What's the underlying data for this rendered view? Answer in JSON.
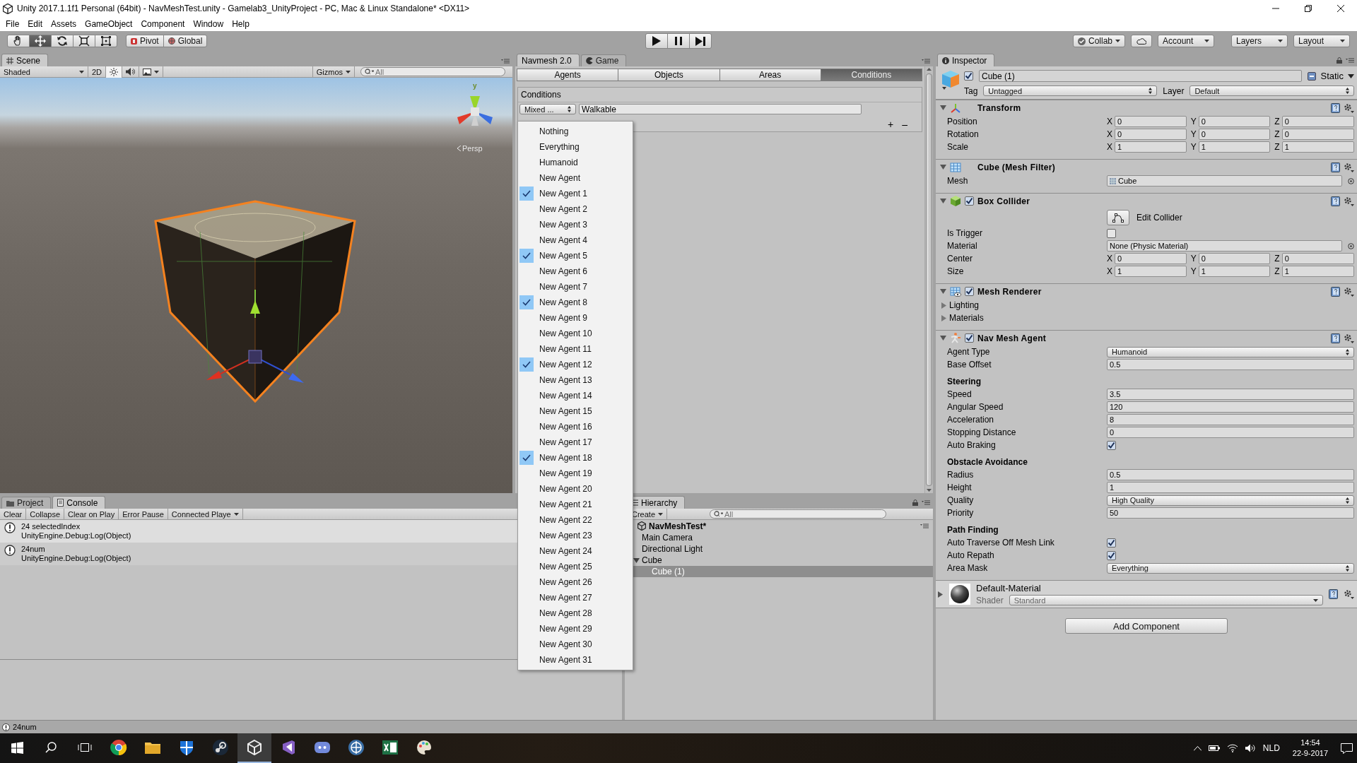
{
  "window": {
    "title": "Unity 2017.1.1f1 Personal (64bit) - NavMeshTest.unity - Gamelab3_UnityProject - PC, Mac & Linux Standalone* <DX11>"
  },
  "menu": [
    "File",
    "Edit",
    "Assets",
    "GameObject",
    "Component",
    "Window",
    "Help"
  ],
  "toolbar": {
    "tools": [
      {
        "kind": "hand",
        "selected": false
      },
      {
        "kind": "move",
        "selected": true
      },
      {
        "kind": "rotate",
        "selected": false
      },
      {
        "kind": "scale",
        "selected": false
      },
      {
        "kind": "rect",
        "selected": false
      }
    ],
    "pivot": "Pivot",
    "global": "Global",
    "collab": "Collab",
    "account": "Account",
    "layers": "Layers",
    "layout": "Layout"
  },
  "scene": {
    "tabs": [
      {
        "kind": "scene",
        "label": "Scene",
        "selected": true
      }
    ],
    "shading": "Shaded",
    "mode_2d": "2D",
    "lighting_on": true,
    "audio_on": false,
    "gizmos": "Gizmos",
    "search_placeholder": "All",
    "gizmo_label": "y",
    "projection": "Persp"
  },
  "navmesh": {
    "tabs": [
      {
        "kind": "plain",
        "label": "Navmesh 2.0",
        "selected": true
      },
      {
        "kind": "game",
        "label": "Game",
        "selected": false
      }
    ],
    "subtabs": [
      {
        "label": "Agents",
        "selected": false
      },
      {
        "label": "Objects",
        "selected": false
      },
      {
        "label": "Areas",
        "selected": false
      },
      {
        "label": "Conditions",
        "selected": true
      }
    ],
    "section": "Conditions",
    "mask": "Mixed ...",
    "name": "Walkable",
    "add": "+",
    "remove": "–",
    "menu": {
      "items": [
        {
          "label": "Nothing",
          "checked": false
        },
        {
          "label": "Everything",
          "checked": false
        },
        {
          "label": "Humanoid",
          "checked": false
        },
        {
          "label": "New Agent",
          "checked": false
        },
        {
          "label": "New Agent 1",
          "checked": true
        },
        {
          "label": "New Agent 2",
          "checked": false
        },
        {
          "label": "New Agent 3",
          "checked": false
        },
        {
          "label": "New Agent 4",
          "checked": false
        },
        {
          "label": "New Agent 5",
          "checked": true
        },
        {
          "label": "New Agent 6",
          "checked": false
        },
        {
          "label": "New Agent 7",
          "checked": false
        },
        {
          "label": "New Agent 8",
          "checked": true
        },
        {
          "label": "New Agent 9",
          "checked": false
        },
        {
          "label": "New Agent 10",
          "checked": false
        },
        {
          "label": "New Agent 11",
          "checked": false
        },
        {
          "label": "New Agent 12",
          "checked": true
        },
        {
          "label": "New Agent 13",
          "checked": false
        },
        {
          "label": "New Agent 14",
          "checked": false
        },
        {
          "label": "New Agent 15",
          "checked": false
        },
        {
          "label": "New Agent 16",
          "checked": false
        },
        {
          "label": "New Agent 17",
          "checked": false
        },
        {
          "label": "New Agent 18",
          "checked": true
        },
        {
          "label": "New Agent 19",
          "checked": false
        },
        {
          "label": "New Agent 20",
          "checked": false
        },
        {
          "label": "New Agent 21",
          "checked": false
        },
        {
          "label": "New Agent 22",
          "checked": false
        },
        {
          "label": "New Agent 23",
          "checked": false
        },
        {
          "label": "New Agent 24",
          "checked": false
        },
        {
          "label": "New Agent 25",
          "checked": false
        },
        {
          "label": "New Agent 26",
          "checked": false
        },
        {
          "label": "New Agent 27",
          "checked": false
        },
        {
          "label": "New Agent 28",
          "checked": false
        },
        {
          "label": "New Agent 29",
          "checked": false
        },
        {
          "label": "New Agent 30",
          "checked": false
        },
        {
          "label": "New Agent 31",
          "checked": false
        }
      ]
    }
  },
  "console": {
    "tabs": [
      {
        "kind": "project",
        "label": "Project",
        "selected": false
      },
      {
        "kind": "console",
        "label": "Console",
        "selected": true
      }
    ],
    "buttons": [
      "Clear",
      "Collapse",
      "Clear on Play",
      "Error Pause"
    ],
    "connected": "Connected Playe",
    "entries": [
      {
        "message": "24 selectedIndex",
        "detail": "UnityEngine.Debug:Log(Object)"
      },
      {
        "message": "24num",
        "detail": "UnityEngine.Debug:Log(Object)"
      }
    ]
  },
  "hierarchy": {
    "tabs": [
      {
        "kind": "hierarchy",
        "label": "Hierarchy",
        "selected": true
      }
    ],
    "create": "Create",
    "search_placeholder": "All",
    "scene": "NavMeshTest*",
    "items": [
      {
        "label": "Main Camera",
        "selected": false
      },
      {
        "label": "Directional Light",
        "selected": false
      },
      {
        "label": "Cube",
        "selected": false,
        "expanded": true,
        "children": [
          {
            "label": "Cube (1)",
            "selected": true
          }
        ]
      }
    ]
  },
  "inspector": {
    "tabs": [
      {
        "kind": "inspector",
        "label": "Inspector",
        "selected": true
      }
    ],
    "object": {
      "active": true,
      "name": "Cube (1)",
      "static_label": "Static",
      "tag_label": "Tag",
      "tag": "Untagged",
      "layer_label": "Layer",
      "layer": "Default"
    },
    "components": [
      {
        "kind": "transform",
        "title": "Transform",
        "expanded": true,
        "rows": [
          {
            "kind": "vector",
            "label": "Position",
            "values": [
              {
                "axis": "X",
                "value": "0"
              },
              {
                "axis": "Y",
                "value": "0"
              },
              {
                "axis": "Z",
                "value": "0"
              }
            ]
          },
          {
            "kind": "vector",
            "label": "Rotation",
            "values": [
              {
                "axis": "X",
                "value": "0"
              },
              {
                "axis": "Y",
                "value": "0"
              },
              {
                "axis": "Z",
                "value": "0"
              }
            ]
          },
          {
            "kind": "vector",
            "label": "Scale",
            "values": [
              {
                "axis": "X",
                "value": "1"
              },
              {
                "axis": "Y",
                "value": "1"
              },
              {
                "axis": "Z",
                "value": "1"
              }
            ]
          }
        ]
      },
      {
        "kind": "mesh_filter",
        "title": "Cube (Mesh Filter)",
        "expanded": true,
        "rows": [
          {
            "kind": "asset",
            "label": "Mesh",
            "value": "Cube"
          }
        ]
      },
      {
        "kind": "box_collider",
        "title": "Box Collider",
        "expanded": true,
        "enabled": true,
        "rows": [
          {
            "kind": "button",
            "label": "Edit Collider"
          },
          {
            "kind": "checkbox",
            "label": "Is Trigger",
            "checked": false
          },
          {
            "kind": "object",
            "label": "Material",
            "value": "None (Physic Material)"
          },
          {
            "kind": "vector",
            "label": "Center",
            "values": [
              {
                "axis": "X",
                "value": "0"
              },
              {
                "axis": "Y",
                "value": "0"
              },
              {
                "axis": "Z",
                "value": "0"
              }
            ]
          },
          {
            "kind": "vector",
            "label": "Size",
            "values": [
              {
                "axis": "X",
                "value": "1"
              },
              {
                "axis": "Y",
                "value": "1"
              },
              {
                "axis": "Z",
                "value": "1"
              }
            ]
          }
        ]
      },
      {
        "kind": "mesh_renderer",
        "title": "Mesh Renderer",
        "expanded": true,
        "enabled": true,
        "rows": [
          {
            "kind": "foldout",
            "label": "Lighting",
            "expanded": false
          },
          {
            "kind": "foldout",
            "label": "Materials",
            "expanded": false
          }
        ]
      },
      {
        "kind": "nav_mesh_agent",
        "title": "Nav Mesh Agent",
        "expanded": true,
        "enabled": true,
        "rows": [
          {
            "kind": "dropdown",
            "label": "Agent Type",
            "value": "Humanoid"
          },
          {
            "kind": "field",
            "label": "Base Offset",
            "value": "0.5"
          },
          {
            "kind": "header",
            "label": "Steering"
          },
          {
            "kind": "field",
            "label": "Speed",
            "value": "3.5"
          },
          {
            "kind": "field",
            "label": "Angular Speed",
            "value": "120"
          },
          {
            "kind": "field",
            "label": "Acceleration",
            "value": "8"
          },
          {
            "kind": "field",
            "label": "Stopping Distance",
            "value": "0"
          },
          {
            "kind": "checkbox",
            "label": "Auto Braking",
            "checked": true
          },
          {
            "kind": "header",
            "label": "Obstacle Avoidance"
          },
          {
            "kind": "field",
            "label": "Radius",
            "value": "0.5"
          },
          {
            "kind": "field",
            "label": "Height",
            "value": "1"
          },
          {
            "kind": "dropdown",
            "label": "Quality",
            "value": "High Quality"
          },
          {
            "kind": "field",
            "label": "Priority",
            "value": "50"
          },
          {
            "kind": "header",
            "label": "Path Finding"
          },
          {
            "kind": "checkbox",
            "label": "Auto Traverse Off Mesh Link",
            "checked": true
          },
          {
            "kind": "checkbox",
            "label": "Auto Repath",
            "checked": true
          },
          {
            "kind": "dropdown",
            "label": "Area Mask",
            "value": "Everything"
          }
        ]
      },
      {
        "kind": "material",
        "title": "Default-Material",
        "expanded": false,
        "shader_label": "Shader",
        "shader": "Standard"
      }
    ],
    "add_component": "Add Component"
  },
  "status_bar": {
    "message": "24num"
  },
  "taskbar": {
    "apps": [
      {
        "kind": "browser",
        "active": false
      },
      {
        "kind": "folder",
        "active": false
      },
      {
        "kind": "shield",
        "active": false
      },
      {
        "kind": "steam",
        "active": false
      },
      {
        "kind": "unity",
        "active": true
      },
      {
        "kind": "studio",
        "active": false
      },
      {
        "kind": "chat",
        "active": false
      },
      {
        "kind": "globe",
        "active": false
      },
      {
        "kind": "sheet",
        "active": false
      },
      {
        "kind": "paint",
        "active": false
      }
    ],
    "language": "NLD",
    "time": "14:54",
    "date": "22-9-2017"
  }
}
